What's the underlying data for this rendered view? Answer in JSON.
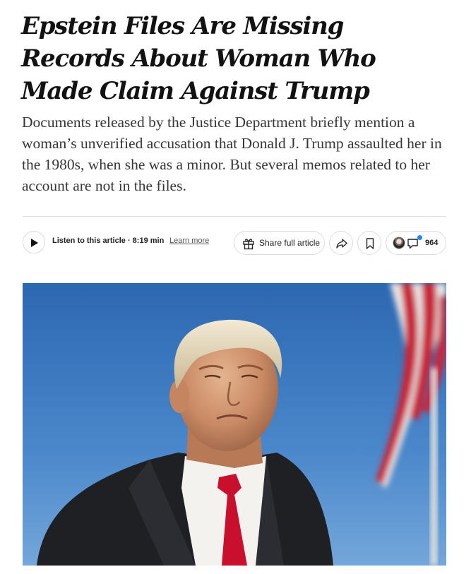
{
  "article": {
    "headline": "Epstein Files Are Missing Records About Woman Who Made Claim Against Trump",
    "summary": "Documents released by the Justice Department briefly mention a woman’s unverified accusation that Donald J. Trump assaulted her in the 1980s, when she was a minor. But several memos related to her account are not in the files."
  },
  "toolbar": {
    "listen_label": "Listen to this article · 8:19 min",
    "learn_more": "Learn more",
    "share_full_label": "Share full article",
    "comment_count": "964",
    "icons": [
      "play-icon",
      "gift-icon",
      "share-icon",
      "bookmark-icon",
      "comment-icon"
    ]
  },
  "colors": {
    "headline": "#121212",
    "summary": "#363636",
    "divider": "#dfdfdf",
    "notification_dot": "#1a8cf0",
    "sky": "#4a86c8"
  }
}
